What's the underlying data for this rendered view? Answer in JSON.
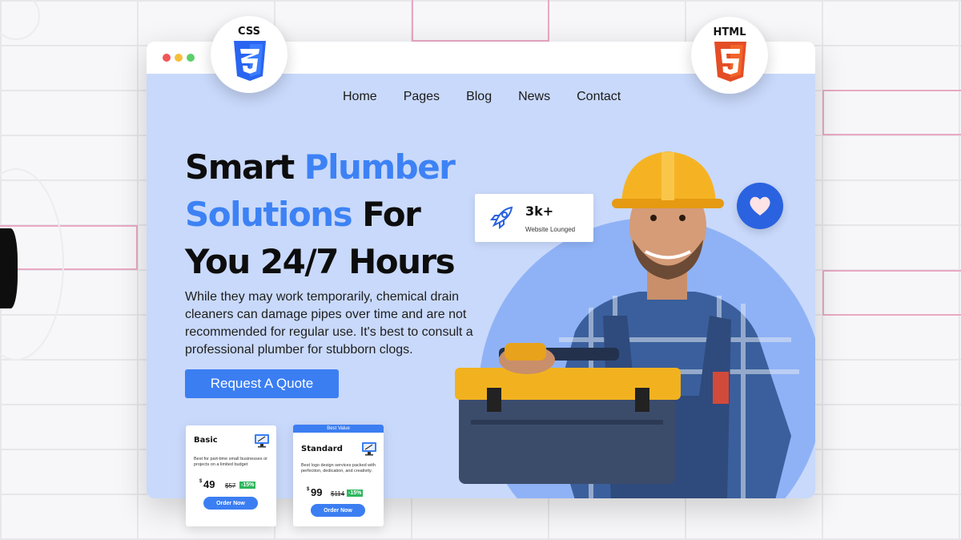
{
  "nav": {
    "items": [
      "Home",
      "Pages",
      "Blog",
      "News",
      "Contact"
    ]
  },
  "hero": {
    "line1_dark": "Smart",
    "line1_blue": "Plumber",
    "line2_blue": "Solutions",
    "line2_dark": "For",
    "line3": "You 24/7 Hours",
    "description": "While they may work temporarily, chemical drain cleaners can damage pipes over time and are not recommended for regular use. It's best to consult a professional plumber for stubborn clogs.",
    "cta_label": "Request A Quote"
  },
  "stat": {
    "value": "3k+",
    "label": "Website Lounged",
    "icon": "rocket-icon"
  },
  "pricing": {
    "basic": {
      "title": "Basic",
      "description": "Best for part-time small businesses or projects on a limited budget",
      "currency": "$",
      "price": "49",
      "old_price": "$57",
      "discount": "-15%",
      "button": "Order Now"
    },
    "standard": {
      "badge": "Best Value",
      "title": "Standard",
      "description": "Best logo design services packed with perfection, dedication, and creativity.",
      "currency": "$",
      "price": "99",
      "old_price": "$114",
      "discount": "-15%",
      "button": "Order Now"
    }
  },
  "badges": {
    "css": "CSS",
    "html": "HTML"
  },
  "colors": {
    "accent": "#3d82f5",
    "hero_bg": "#c9d9fb",
    "discount": "#2eb65c",
    "html5": "#e44d26",
    "css3": "#2965f1"
  }
}
